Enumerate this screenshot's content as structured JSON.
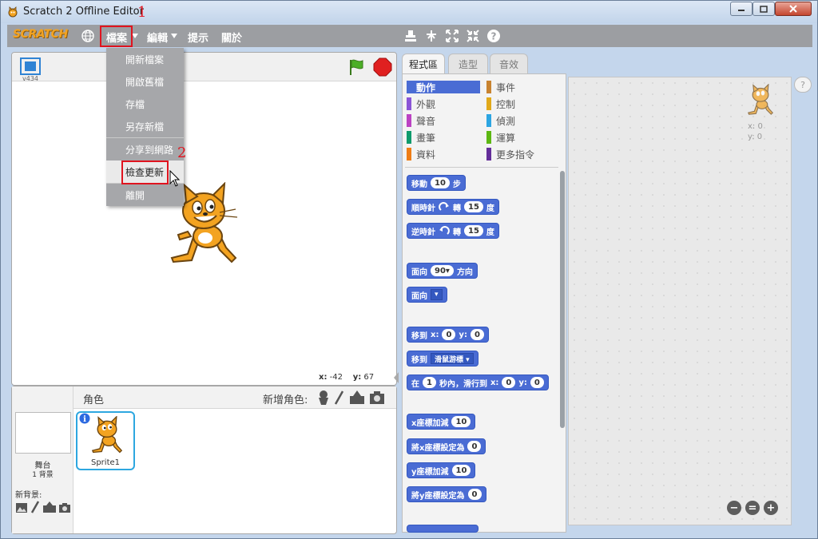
{
  "window": {
    "title": "Scratch 2 Offline Editor"
  },
  "menubar": {
    "logo": "SCRATCH",
    "file": "檔案",
    "edit": "編輯",
    "tips": "提示",
    "about": "關於"
  },
  "annotations": {
    "mark1": "1",
    "mark2": "2"
  },
  "file_menu": {
    "items": [
      "開新檔案",
      "開啟舊檔",
      "存檔",
      "另存新檔",
      "分享到網路",
      "檢查更新",
      "離開"
    ],
    "hovered_index": 5
  },
  "stage": {
    "version": "v434",
    "x_label": "x:",
    "x_value": "-42",
    "y_label": "y:",
    "y_value": "67"
  },
  "sprites": {
    "header": "角色",
    "new_sprite": "新增角色:",
    "stage_label": "舞台",
    "backdrop_count": "1 背景",
    "new_backdrop": "新背景:",
    "sprite_name": "Sprite1"
  },
  "tabs": [
    "程式區",
    "造型",
    "音效"
  ],
  "categories": [
    {
      "label": "動作",
      "color": "#4a6cd4"
    },
    {
      "label": "事件",
      "color": "#c88330"
    },
    {
      "label": "外觀",
      "color": "#8a55d7"
    },
    {
      "label": "控制",
      "color": "#e1a91a"
    },
    {
      "label": "聲音",
      "color": "#bb42c3"
    },
    {
      "label": "偵測",
      "color": "#2ca5e2"
    },
    {
      "label": "畫筆",
      "color": "#0e9a6c"
    },
    {
      "label": "運算",
      "color": "#5cb712"
    },
    {
      "label": "資料",
      "color": "#ee7d16"
    },
    {
      "label": "更多指令",
      "color": "#632d99"
    }
  ],
  "blocks": {
    "move": {
      "a": "移動",
      "v": "10",
      "b": "步"
    },
    "turn_cw": {
      "a": "順時針",
      "b": "轉",
      "v": "15",
      "c": "度"
    },
    "turn_ccw": {
      "a": "逆時針",
      "b": "轉",
      "v": "15",
      "c": "度"
    },
    "point_dir": {
      "a": "面向",
      "v": "90▾",
      "b": "方向"
    },
    "point_to": {
      "a": "面向",
      "v": "▾"
    },
    "goto_xy": {
      "a": "移到",
      "xl": "x:",
      "x": "0",
      "yl": "y:",
      "y": "0"
    },
    "goto": {
      "a": "移到",
      "v": "滑鼠游標 ▾"
    },
    "glide": {
      "a": "在",
      "s": "1",
      "b": "秒內，滑行到",
      "xl": "x:",
      "x": "0",
      "yl": "y:",
      "y": "0"
    },
    "change_x": {
      "a": "x座標加減",
      "v": "10"
    },
    "set_x": {
      "a": "將x座標設定為",
      "v": "0"
    },
    "change_y": {
      "a": "y座標加減",
      "v": "10"
    },
    "set_y": {
      "a": "將y座標設定為",
      "v": "0"
    }
  },
  "scripts_area": {
    "x_label": "x: 0",
    "y_label": "y: 0"
  }
}
